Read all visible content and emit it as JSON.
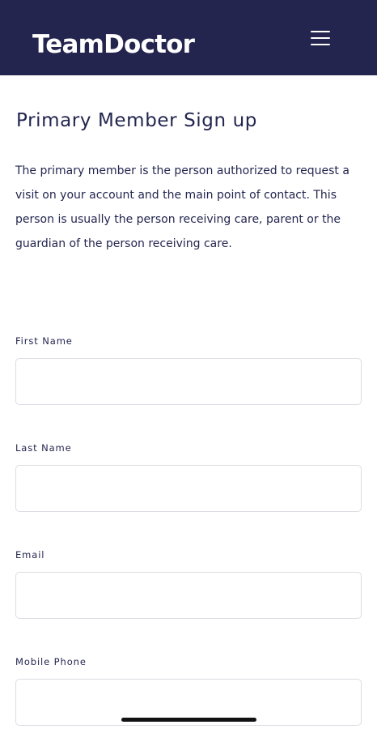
{
  "header": {
    "logo_text": "TeamDoctor",
    "menu_icon": "hamburger-menu-icon"
  },
  "main": {
    "title": "Primary Member Sign up",
    "intro_text": "The primary member is the person authorized to request a visit on your account and the main point of contact. This person is usually the person receiving care, parent or the guardian of the person receiving care."
  },
  "form": {
    "first_name": {
      "label": "First Name",
      "value": ""
    },
    "last_name": {
      "label": "Last Name",
      "value": ""
    },
    "email": {
      "label": "Email",
      "value": ""
    },
    "mobile_phone": {
      "label": "Mobile Phone",
      "value": ""
    }
  },
  "colors": {
    "header_background": "#24254f",
    "text_primary": "#23264f",
    "input_border": "#dcdde3"
  }
}
